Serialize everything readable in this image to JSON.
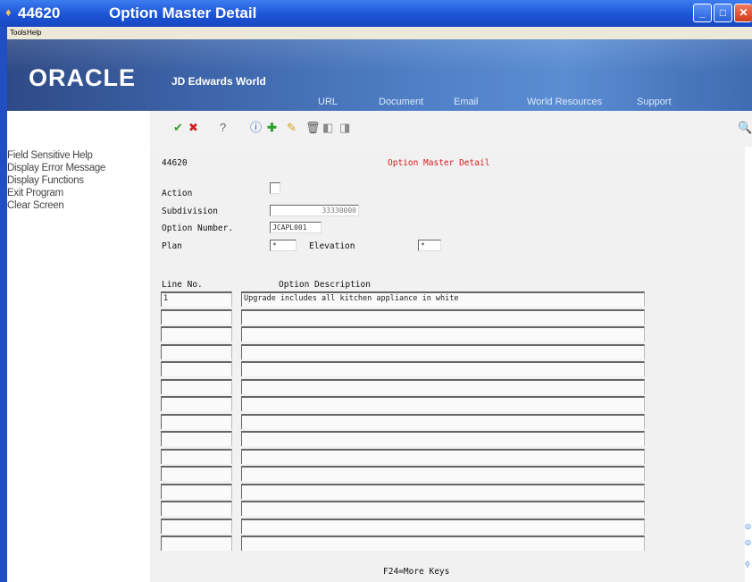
{
  "window": {
    "code": "44620",
    "title": "Option Master Detail"
  },
  "menu": [
    "Tools",
    "Help"
  ],
  "banner": {
    "logo": "ORACLE",
    "product": "JD Edwards World",
    "links": [
      "URL",
      "Document",
      "Email",
      "World Resources",
      "Support"
    ]
  },
  "toolbar_icons": [
    "check-icon",
    "cancel-icon",
    "help-icon",
    "inquire-icon",
    "add-icon",
    "edit-icon",
    "delete-icon",
    "previous-icon",
    "next-icon",
    "search-icon"
  ],
  "sidebar": {
    "items": [
      "Field Sensitive Help",
      "Display Error Message",
      "Display Functions",
      "Exit Program",
      "Clear Screen"
    ]
  },
  "form": {
    "program_id": "44620",
    "heading": "Option Master Detail",
    "action_label": "Action",
    "action_value": "",
    "subdivision_label": "Subdivision",
    "subdivision_value": "33330000",
    "option_number_label": "Option Number.",
    "option_number_value": "JCAPL001",
    "plan_label": "Plan",
    "plan_value": "*",
    "elevation_label": "Elevation",
    "elevation_value": "*",
    "col_line_no": "Line No.",
    "col_option_desc": "Option Description",
    "rows": [
      {
        "line": "1",
        "desc": "Upgrade includes all kitchen appliance in white"
      },
      {
        "line": "",
        "desc": ""
      },
      {
        "line": "",
        "desc": ""
      },
      {
        "line": "",
        "desc": ""
      },
      {
        "line": "",
        "desc": ""
      },
      {
        "line": "",
        "desc": ""
      },
      {
        "line": "",
        "desc": ""
      },
      {
        "line": "",
        "desc": ""
      },
      {
        "line": "",
        "desc": ""
      },
      {
        "line": "",
        "desc": ""
      },
      {
        "line": "",
        "desc": ""
      },
      {
        "line": "",
        "desc": ""
      },
      {
        "line": "",
        "desc": ""
      },
      {
        "line": "",
        "desc": ""
      },
      {
        "line": "",
        "desc": ""
      }
    ],
    "footer": "F24=More Keys"
  }
}
